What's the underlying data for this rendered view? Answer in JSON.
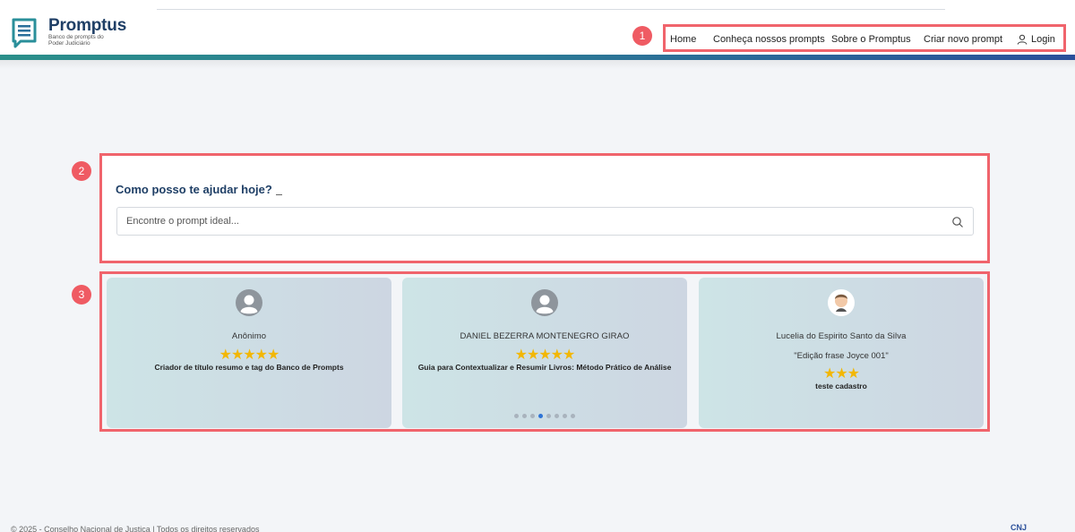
{
  "app": {
    "name": "Promptus",
    "tagline_line1": "Banco de prompts do",
    "tagline_line2": "Poder Judiciário"
  },
  "nav": {
    "badge": "1",
    "items": [
      {
        "label": "Home"
      },
      {
        "label": "Conheça nossos prompts"
      },
      {
        "label": "Sobre o Promptus"
      },
      {
        "label": "Criar novo prompt"
      },
      {
        "label": "Login",
        "icon": "user-icon"
      }
    ]
  },
  "search": {
    "badge": "2",
    "title": "Como posso te ajudar hoje?",
    "placeholder": "Encontre o prompt ideal...",
    "icon": "search-icon"
  },
  "carousel": {
    "badge": "3",
    "cards": [
      {
        "author": "Anônimo",
        "rating": 5,
        "stars": "★★★★★",
        "title": "Criador de título resumo e tag do Banco de Prompts",
        "avatar": "default-avatar-icon"
      },
      {
        "author": "DANIEL BEZERRA MONTENEGRO GIRAO",
        "rating": 5,
        "stars": "★★★★★",
        "title": "Guia para Contextualizar e Resumir Livros: Método Prático de Análise",
        "avatar": "default-avatar-icon"
      },
      {
        "author": "Lucelia do Espirito Santo da Silva",
        "phrase": "\"Edição frase Joyce 001\"",
        "rating": 3,
        "stars": "★★★",
        "title": "teste cadastro",
        "avatar": "user-photo-avatar"
      }
    ],
    "pagination": {
      "total": 8,
      "active_index": 3
    }
  },
  "footer": {
    "text": "© 2025 - Conselho Nacional de Justiça | Todos os direitos reservados",
    "logo_text": "CNJ"
  },
  "colors": {
    "highlight": "#f0646c",
    "brand": "#1f3f66",
    "star": "#f2b705",
    "active_dot": "#2e74d6"
  }
}
